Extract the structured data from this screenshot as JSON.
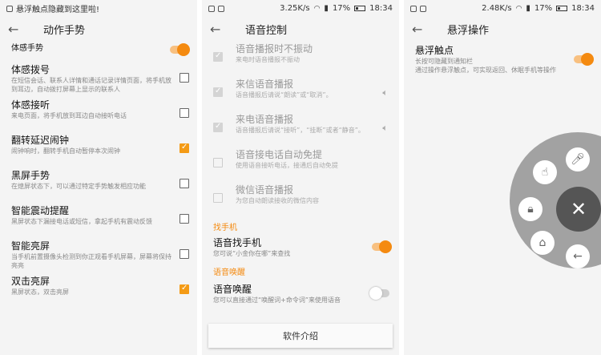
{
  "accent_color": "#f48a10",
  "panel1": {
    "status": {
      "notice": "悬浮触点隐藏到这里啦!",
      "speed": "",
      "battery": "",
      "time": ""
    },
    "title": "动作手势",
    "master": {
      "label": "体感手势",
      "on": true
    },
    "items": [
      {
        "title": "体感拨号",
        "desc": "在短信会话、联系人详情和通话记录详情页面，将手机放到耳边，自动拨打屏幕上显示的联系人",
        "checked": false
      },
      {
        "title": "体感接听",
        "desc": "来电页面，将手机放到耳边自动接听电话",
        "checked": false
      },
      {
        "title": "翻转延迟闹钟",
        "desc": "闹钟响时，翻转手机自动暂停本次闹钟",
        "checked": true
      },
      {
        "title": "黑屏手势",
        "desc": "在熄屏状态下，可以通过特定手势触发相应功能",
        "checked": false
      },
      {
        "title": "智能震动提醒",
        "desc": "黑屏状态下漏接电话或短信，拿起手机有震动反馈",
        "checked": false
      },
      {
        "title": "智能亮屏",
        "desc": "当手机前置摄像头检测到你正观看手机屏幕，屏幕将保持亮亮",
        "checked": false
      },
      {
        "title": "双击亮屏",
        "desc": "黑屏状态，双击亮屏",
        "checked": true
      }
    ]
  },
  "panel2": {
    "status": {
      "speed": "3.25K/s",
      "battery": "17%",
      "time": "18:34"
    },
    "title": "语音控制",
    "items": [
      {
        "title": "语音播报时不振动",
        "desc": "来电时语音播报不振动",
        "checked": true,
        "disabled": true
      },
      {
        "title": "来信语音播报",
        "desc": "语音播报后请说“朗读”或“取消”。",
        "checked": true,
        "disabled": true,
        "speaker": "speaker-icon"
      },
      {
        "title": "来电语音播报",
        "desc": "语音播报后请说“接听”，“挂断”或者“静音”。",
        "checked": true,
        "disabled": true,
        "speaker": "speaker-icon"
      },
      {
        "title": "语音接电话自动免提",
        "desc": "使用语音接听电话，接通后自动免提",
        "checked": false,
        "disabled": true
      },
      {
        "title": "微信语音播报",
        "desc": "为您自动朗读接收的微信内容",
        "checked": false,
        "disabled": true
      }
    ],
    "section_find": "找手机",
    "find": {
      "title": "语音找手机",
      "desc": "您可说“小金你在哪”来查找",
      "on": true
    },
    "section_wake": "语音唤醒",
    "wake": {
      "title": "语音唤醒",
      "desc": "您可以直接通过“唤醒词+命令词”来使用语音",
      "on": false
    },
    "intro_button": "软件介绍"
  },
  "panel3": {
    "status": {
      "speed": "2.48K/s",
      "battery": "17%",
      "time": "18:34"
    },
    "title": "悬浮操作",
    "item": {
      "title": "悬浮触点",
      "desc": "长按可隐藏到通知栏\n通过操作悬浮触点，可实现返回、休眠手机等操作",
      "on": true
    },
    "wheel": {
      "buttons": [
        "gesture-icon",
        "microphone-icon",
        "lock-icon",
        "home-icon",
        "back-icon",
        "close-icon"
      ]
    }
  }
}
